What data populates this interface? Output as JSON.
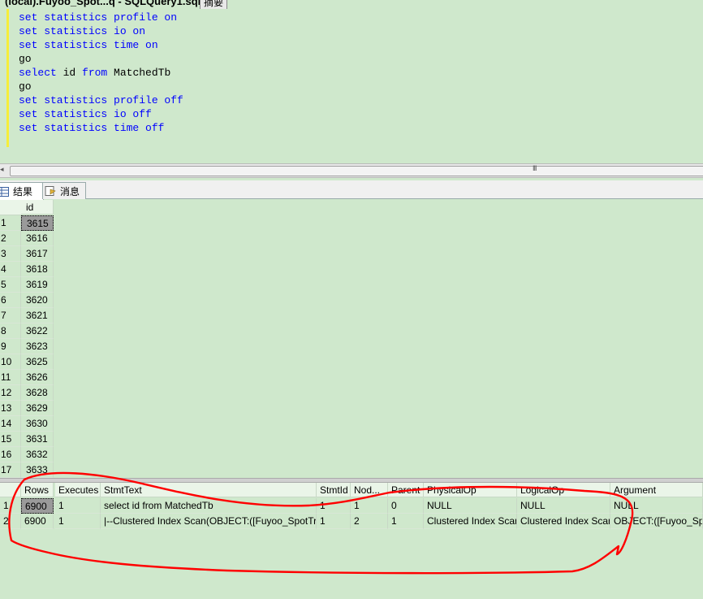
{
  "window": {
    "tab_title": "(local).Fuyoo_Spot...q - SQLQuery1.sql*",
    "tab_other": "摘要"
  },
  "editor": {
    "lines": [
      [
        {
          "t": "set statistics profile on",
          "k": true
        }
      ],
      [
        {
          "t": "set statistics io on",
          "k": true
        }
      ],
      [
        {
          "t": "set statistics time on",
          "k": true
        }
      ],
      [
        {
          "t": "go",
          "k": false
        }
      ],
      [
        {
          "t": "select",
          "k": true
        },
        {
          "t": " id ",
          "k": false
        },
        {
          "t": "from",
          "k": true
        },
        {
          "t": " MatchedTb",
          "k": false
        }
      ],
      [
        {
          "t": "go",
          "k": false
        }
      ],
      [
        {
          "t": "set statistics profile off",
          "k": true
        }
      ],
      [
        {
          "t": "set statistics io off",
          "k": true
        }
      ],
      [
        {
          "t": "set statistics time off",
          "k": true
        }
      ]
    ]
  },
  "scrollbar": {
    "grip": "III"
  },
  "result_tabs": [
    {
      "label": "结果",
      "icon": "grid-icon"
    },
    {
      "label": "消息",
      "icon": "message-icon"
    }
  ],
  "results1": {
    "column": "id",
    "rows": [
      {
        "n": "1",
        "id": "3615"
      },
      {
        "n": "2",
        "id": "3616"
      },
      {
        "n": "3",
        "id": "3617"
      },
      {
        "n": "4",
        "id": "3618"
      },
      {
        "n": "5",
        "id": "3619"
      },
      {
        "n": "6",
        "id": "3620"
      },
      {
        "n": "7",
        "id": "3621"
      },
      {
        "n": "8",
        "id": "3622"
      },
      {
        "n": "9",
        "id": "3623"
      },
      {
        "n": "10",
        "id": "3625"
      },
      {
        "n": "11",
        "id": "3626"
      },
      {
        "n": "12",
        "id": "3628"
      },
      {
        "n": "13",
        "id": "3629"
      },
      {
        "n": "14",
        "id": "3630"
      },
      {
        "n": "15",
        "id": "3631"
      },
      {
        "n": "16",
        "id": "3632"
      },
      {
        "n": "17",
        "id": "3633"
      }
    ]
  },
  "results2": {
    "columns": [
      "Rows",
      "Executes",
      "StmtText",
      "StmtId",
      "Nod...",
      "Parent",
      "PhysicalOp",
      "LogicalOp",
      "Argument"
    ],
    "rows": [
      {
        "n": "1",
        "cells": [
          "6900",
          "1",
          "select id from MatchedTb",
          "1",
          "1",
          "0",
          "NULL",
          "NULL",
          "NULL"
        ]
      },
      {
        "n": "2",
        "cells": [
          "6900",
          "1",
          "|--Clustered Index Scan(OBJECT:([Fuyoo_SpotTra...",
          "1",
          "2",
          "1",
          "Clustered Index Scan",
          "Clustered Index Scan",
          "OBJECT:([Fuyoo_SpotT"
        ]
      }
    ]
  },
  "colors": {
    "background": "#cfe8cc",
    "keyword": "#0000ff",
    "annotation": "#ff0000"
  }
}
